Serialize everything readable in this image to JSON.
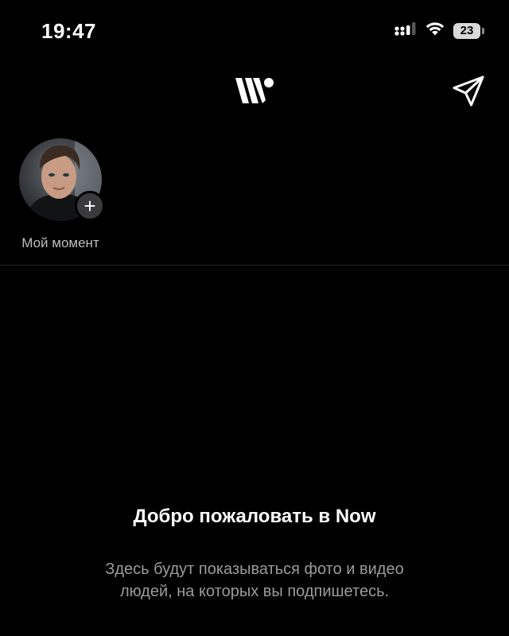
{
  "status_bar": {
    "time": "19:47",
    "battery_level": "23",
    "icons": [
      "cellular-signal-icon",
      "wifi-icon",
      "battery-icon"
    ]
  },
  "header": {
    "logo_icon": "w-dot-logo-icon",
    "send_icon": "paper-plane-icon"
  },
  "moment": {
    "label": "Мой момент",
    "add_symbol": "+"
  },
  "empty_state": {
    "title": "Добро пожаловать в Now",
    "text": "Здесь будут показываться фото и видео людей, на которых вы подпишетесь."
  },
  "colors": {
    "background": "#000000",
    "primary_text": "#ffffff",
    "secondary_text": "#9b9b9b",
    "badge_background": "#3a3a3c"
  }
}
